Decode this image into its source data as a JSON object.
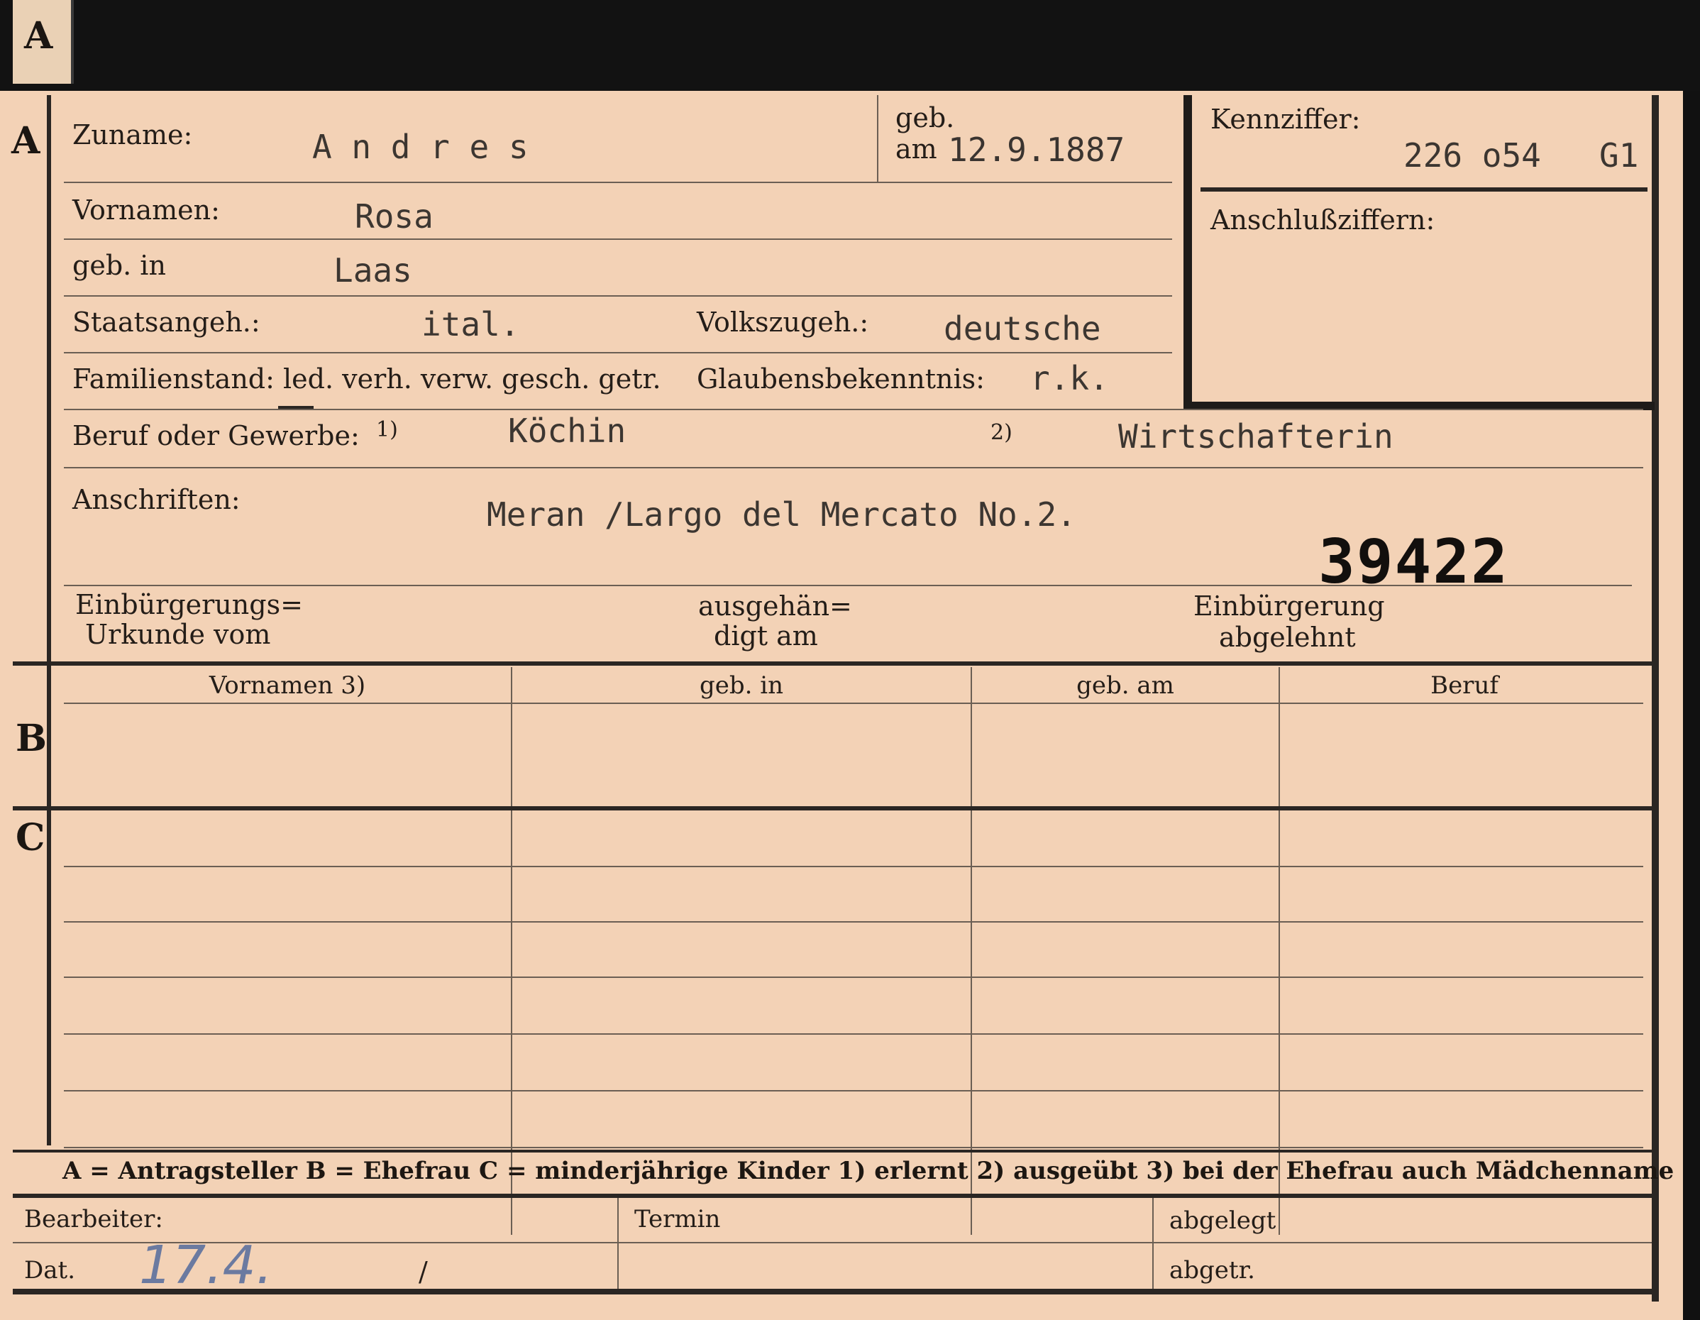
{
  "card": {
    "tab_letter": "A",
    "section_a_letter": "A",
    "section_b_letter": "B",
    "section_c_letter": "C",
    "surname_label": "Zuname:",
    "surname_value": "A n d r e s",
    "born_label_top": "geb.",
    "born_on_label": "am",
    "born_on_value": "12.9.1887",
    "kennziffer_label": "Kennziffer:",
    "kennziffer_value": "226 o54",
    "kennziffer_suffix": "G1",
    "anschluss_label": "Anschlußziffern:",
    "firstnames_label": "Vornamen:",
    "firstnames_value": "Rosa",
    "birthplace_label": "geb. in",
    "birthplace_value": "Laas",
    "citizenship_label": "Staatsangeh.:",
    "citizenship_value": "ital.",
    "ethnicity_label": "Volkszugeh.:",
    "ethnicity_value": "deutsche",
    "family_status_label": "Familienstand: led. verh. verw. gesch. getr.",
    "religion_label": "Glaubensbekenntnis:",
    "religion_value": "r.k.",
    "profession_label": "Beruf oder Gewerbe:",
    "profession_note1": "1)",
    "profession_value1": "Köchin",
    "profession_note2": "2)",
    "profession_value2": "Wirtschafterin",
    "addresses_label": "Anschriften:",
    "address_value": "Meran /Largo del Mercato  No.2.",
    "stamp_number": "39422",
    "naturalization_label_1": "Einbürgerungs=",
    "naturalization_label_2": "Urkunde vom",
    "handed_label_1": "ausgehän=",
    "handed_label_2": "digt am",
    "rejected_label_1": "Einbürgerung",
    "rejected_label_2": "abgelehnt",
    "col_firstnames": "Vornamen 3)",
    "col_birthplace": "geb. in",
    "col_birthdate": "geb. am",
    "col_profession": "Beruf",
    "legend": "A = Antragsteller   B = Ehefrau   C = minderjährige Kinder   1) erlernt   2) ausgeübt   3) bei der Ehefrau auch Mädchenname",
    "editor_label": "Bearbeiter:",
    "date_label": "Dat.",
    "date_handwritten": "17.4.",
    "date_slash": "/",
    "deadline_label": "Termin",
    "filed_label": "abgelegt",
    "sent_label": "abgetr."
  }
}
